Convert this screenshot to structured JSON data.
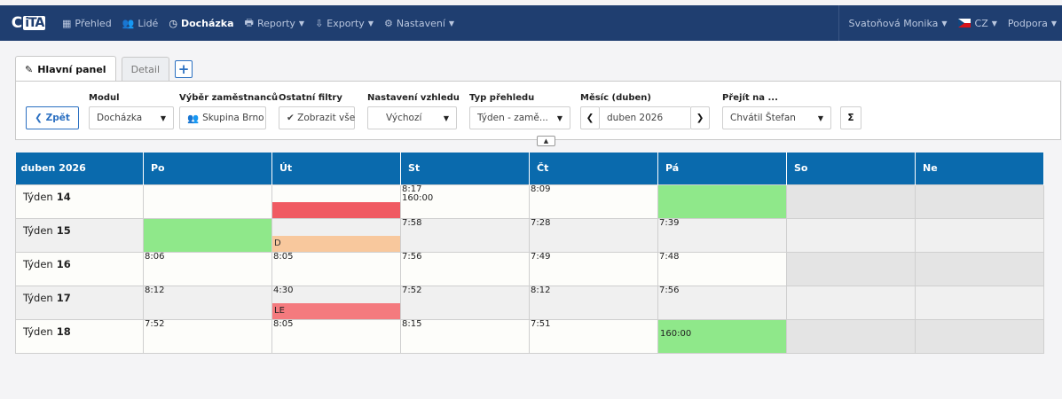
{
  "brand": {
    "logo_c": "C",
    "logo_text": "iTA"
  },
  "nav": {
    "items": [
      {
        "label": "Přehled",
        "icon": "grid-icon",
        "glyph": "▦",
        "active": false,
        "dropdown": false
      },
      {
        "label": "Lidé",
        "icon": "users-icon",
        "glyph": "👥",
        "active": false,
        "dropdown": false
      },
      {
        "label": "Docházka",
        "icon": "clock-icon",
        "glyph": "◷",
        "active": true,
        "dropdown": false
      },
      {
        "label": "Reporty",
        "icon": "print-icon",
        "glyph": "🖶",
        "active": false,
        "dropdown": true
      },
      {
        "label": "Exporty",
        "icon": "export-icon",
        "glyph": "⇩",
        "active": false,
        "dropdown": true
      },
      {
        "label": "Nastavení",
        "icon": "gear-icon",
        "glyph": "⚙",
        "active": false,
        "dropdown": true
      }
    ],
    "user": "Svatoňová Monika",
    "language": "CZ",
    "support": "Podpora"
  },
  "tabs": {
    "main": "Hlavní panel",
    "detail": "Detail",
    "add": "+"
  },
  "filters": {
    "back": "❮ Zpět",
    "modul_label": "Modul",
    "modul_value": "Docházka",
    "employees_label": "Výběr zaměstnanců",
    "employees_value": "Skupina Brno",
    "other_label": "Ostatní filtry",
    "other_value": "✔ Zobrazit vše",
    "view_label": "Nastavení vzhledu",
    "view_value": "Výchozí",
    "type_label": "Typ přehledu",
    "type_value": "Týden - zamě...",
    "month_label": "Měsíc (duben)",
    "month_value": "duben 2026",
    "goto_label": "Přejít na ...",
    "goto_value": "Chvátil Štefan",
    "sum": "Σ"
  },
  "calendar": {
    "month": "duben 2026",
    "days": [
      "Po",
      "Út",
      "St",
      "Čt",
      "Pá",
      "So",
      "Ne"
    ],
    "week_prefix": "Týden",
    "weeks": [
      {
        "num": "14",
        "cells": [
          {
            "time": "",
            "fill": ""
          },
          {
            "time": "",
            "bar": "red",
            "bar_label": ""
          },
          {
            "time": "8:17\n160:00"
          },
          {
            "time": "8:09"
          },
          {
            "time": "",
            "fill": "green"
          },
          {
            "weekend": true
          },
          {
            "weekend": true
          }
        ]
      },
      {
        "num": "15",
        "cells": [
          {
            "time": "",
            "fill": "green"
          },
          {
            "time": "",
            "bar": "orange",
            "bar_label": "D"
          },
          {
            "time": "7:58"
          },
          {
            "time": "7:28"
          },
          {
            "time": "7:39"
          },
          {
            "weekend": true
          },
          {
            "weekend": true
          }
        ]
      },
      {
        "num": "16",
        "cells": [
          {
            "time": "8:06"
          },
          {
            "time": "8:05"
          },
          {
            "time": "7:56"
          },
          {
            "time": "7:49"
          },
          {
            "time": "7:48"
          },
          {
            "weekend": true
          },
          {
            "weekend": true
          }
        ]
      },
      {
        "num": "17",
        "cells": [
          {
            "time": "8:12"
          },
          {
            "time": "4:30",
            "bar": "salmon",
            "bar_label": "LE"
          },
          {
            "time": "7:52"
          },
          {
            "time": "8:12"
          },
          {
            "time": "7:56"
          },
          {
            "weekend": true
          },
          {
            "weekend": true
          }
        ]
      },
      {
        "num": "18",
        "cells": [
          {
            "time": "7:52"
          },
          {
            "time": "8:05"
          },
          {
            "time": "8:15"
          },
          {
            "time": "7:51"
          },
          {
            "time": "",
            "fill": "green",
            "green_label": "160:00"
          },
          {
            "weekend": true
          },
          {
            "weekend": true
          }
        ]
      }
    ]
  }
}
